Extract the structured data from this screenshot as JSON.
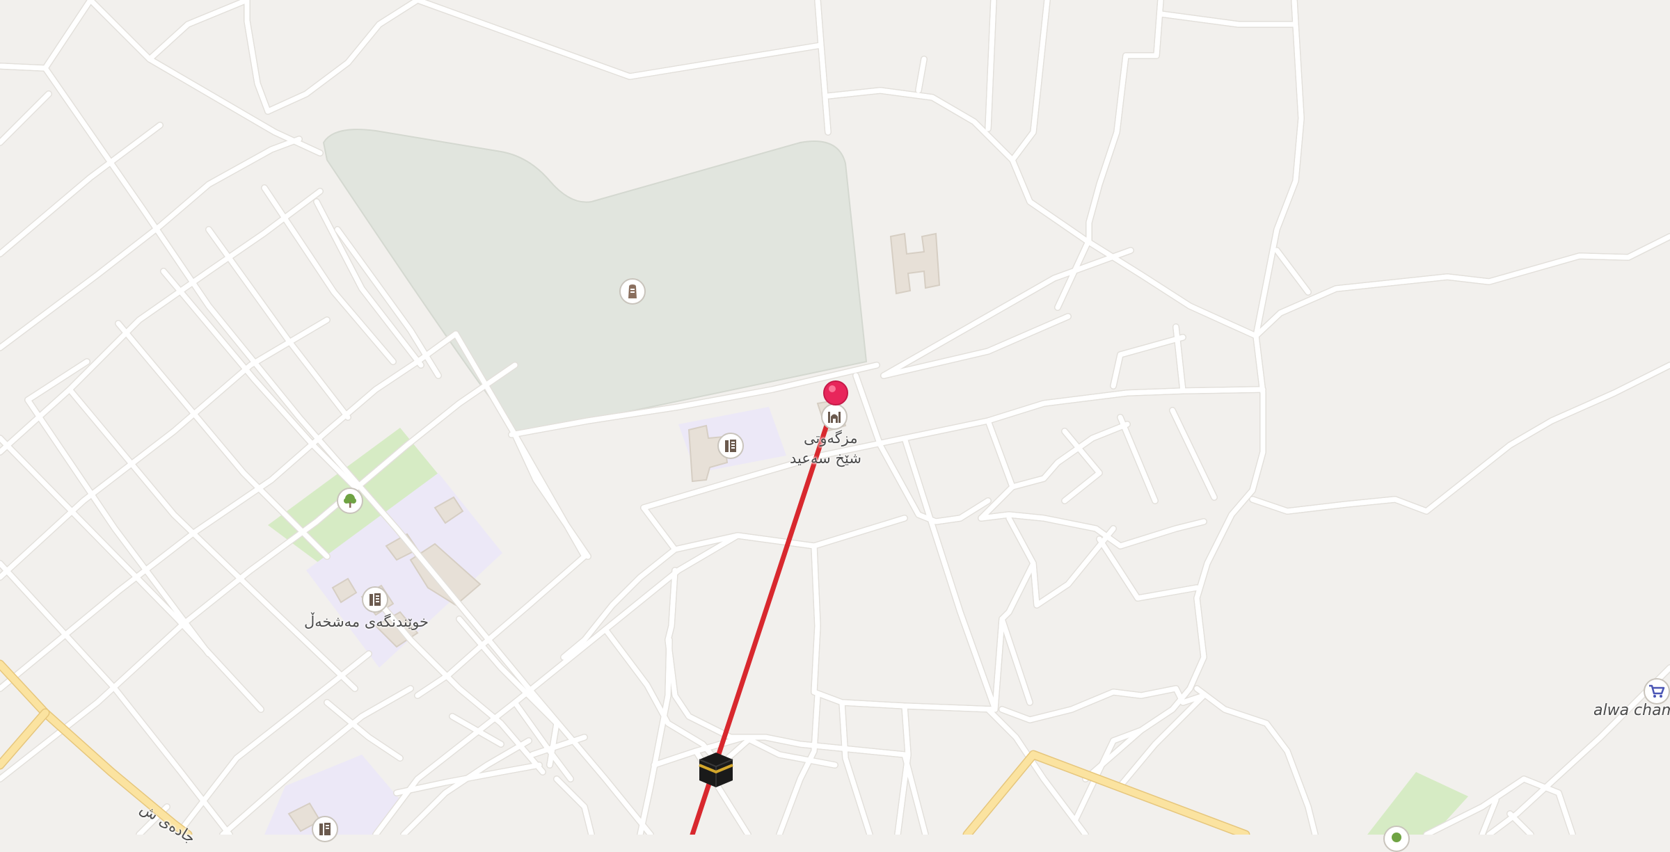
{
  "map": {
    "labels": {
      "mosque_line1": "مزگەوتی",
      "mosque_line2": "شێخ سەعید",
      "school": "خوێندنگەی مەشخەڵ",
      "street": "جادەی ش",
      "shop": "alwa cham"
    },
    "icons": {
      "pin": "pin-marker-icon",
      "kaaba": "kaaba-icon",
      "cemetery": "cemetery-icon",
      "mosque": "mosque-icon",
      "school": "school-icon",
      "park": "tree-icon",
      "shop": "shopping-cart-icon"
    },
    "colors": {
      "background": "#f2f0ed",
      "park": "#d6ebc4",
      "cemetery": "#e1e5de",
      "school_area": "#ece8f7",
      "route": "#d8282e",
      "pin": "#e8265b",
      "major_road": "#fbe3a0"
    }
  }
}
